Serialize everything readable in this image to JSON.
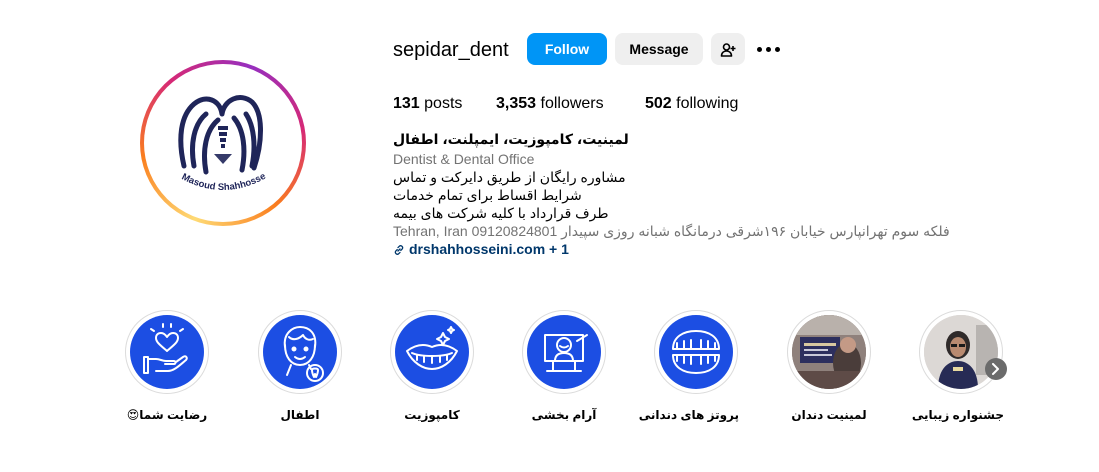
{
  "profile": {
    "username": "sepidar_dent",
    "avatar_logo_text": "Dr.Masoud Shahhosseini",
    "follow_label": "Follow",
    "message_label": "Message",
    "add_user_icon": "add-user-icon",
    "more_icon": "more-options-icon"
  },
  "stats": {
    "posts_count": "131",
    "posts_label": "posts",
    "followers_count": "3,353",
    "followers_label": "followers",
    "following_count": "502",
    "following_label": "following"
  },
  "bio": {
    "name": "لمینیت، کامپوزیت، ایمپلنت، اطفال",
    "category": "Dentist & Dental Office",
    "lines": [
      "مشاوره رایگان از طریق دایرکت و تماس",
      "شرایط اقساط برای تمام خدمات",
      "طرف قرارداد با کلیه شرکت های بیمه"
    ],
    "address": "Tehran, Iran 09120824801 فلکه سوم تهرانپارس خیابان ۱۹۶شرقی درمانگاه شبانه روزی سپیدار",
    "link_text": "drshahhosseini.com",
    "link_extra": "+ 1",
    "link_icon": "link-icon"
  },
  "highlights": [
    {
      "label": "رضایت شما😍",
      "icon": "heart-hand-icon"
    },
    {
      "label": "اطفال",
      "icon": "child-tooth-icon"
    },
    {
      "label": "کامپوزیت",
      "icon": "smile-sparkle-icon"
    },
    {
      "label": "آرام بخشی",
      "icon": "sedation-icon"
    },
    {
      "label": "پروتز های دندانی",
      "icon": "denture-icon"
    },
    {
      "label": "لمینیت دندان",
      "icon": "laminate-photo"
    },
    {
      "label": "جشنواره زیبایی",
      "icon": "beauty-festival-photo"
    }
  ],
  "colors": {
    "follow_button": "#0095f6",
    "secondary_button": "#efefef",
    "highlight_bg": "#1c4ee3",
    "link_color": "#00376b",
    "muted_text": "#737373",
    "logo_navy": "#1f2559"
  }
}
